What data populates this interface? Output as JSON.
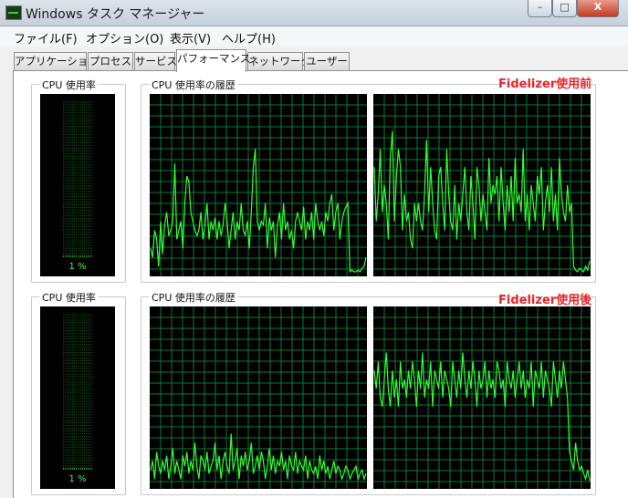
{
  "window": {
    "title": "Windows タスク マネージャー"
  },
  "titlebar_buttons": {
    "minimize": "–",
    "maximize": "□",
    "close": "X"
  },
  "menu": [
    "ファイル(F)",
    "オプション(O)",
    "表示(V)",
    "ヘルプ(H)"
  ],
  "tabs": [
    {
      "label": "アプリケーション",
      "active": false
    },
    {
      "label": "プロセス",
      "active": false
    },
    {
      "label": "サービス",
      "active": false
    },
    {
      "label": "パフォーマンス",
      "active": true
    },
    {
      "label": "ネットワーク",
      "active": false
    },
    {
      "label": "ユーザー",
      "active": false
    }
  ],
  "colors": {
    "graph_line": "#33ff33",
    "grid": "#0e7a32",
    "meter_on": "#3cff3c",
    "meter_off": "#0a5c1a",
    "annotation": "#e8262a"
  },
  "sections": [
    {
      "note": "Fidelizer使用前",
      "usage_label": "CPU 使用率",
      "usage_value": "1 %",
      "usage_fraction": 0.01,
      "history_label": "CPU 使用率の履歴",
      "cores": [
        {
          "values": [
            15,
            10,
            25,
            20,
            5,
            30,
            12,
            28,
            35,
            22,
            25,
            30,
            62,
            20,
            25,
            30,
            15,
            40,
            55,
            52,
            35,
            30,
            25,
            22,
            25,
            35,
            20,
            28,
            40,
            20,
            30,
            25,
            32,
            20,
            30,
            22,
            28,
            40,
            30,
            15,
            25,
            35,
            20,
            30,
            25,
            40,
            25,
            22,
            30,
            15,
            35,
            60,
            70,
            30,
            25,
            30,
            28,
            40,
            15,
            32,
            25,
            30,
            10,
            28,
            35,
            20,
            40,
            25,
            30,
            20,
            25,
            15,
            30,
            35,
            30,
            25,
            38,
            20,
            30,
            25,
            35,
            20,
            40,
            30,
            25,
            30,
            22,
            35,
            30,
            40,
            45,
            25,
            35,
            40,
            20,
            30,
            35,
            38,
            40,
            2,
            3,
            2,
            2,
            3,
            2,
            4,
            5,
            10
          ]
        },
        {
          "values": [
            60,
            30,
            45,
            70,
            35,
            50,
            40,
            20,
            65,
            80,
            30,
            55,
            70,
            60,
            25,
            45,
            30,
            35,
            20,
            15,
            40,
            30,
            40,
            30,
            25,
            45,
            75,
            35,
            60,
            40,
            25,
            20,
            55,
            60,
            40,
            25,
            70,
            45,
            30,
            25,
            50,
            20,
            40,
            30,
            45,
            60,
            35,
            25,
            55,
            40,
            20,
            60,
            50,
            30,
            45,
            35,
            25,
            65,
            40,
            50,
            45,
            55,
            30,
            60,
            40,
            25,
            50,
            35,
            55,
            30,
            65,
            40,
            45,
            35,
            70,
            30,
            45,
            25,
            50,
            40,
            30,
            55,
            45,
            60,
            25,
            40,
            50,
            35,
            60,
            30,
            45,
            25,
            65,
            45,
            35,
            30,
            50,
            35,
            40,
            5,
            3,
            2,
            4,
            3,
            2,
            5,
            3,
            8
          ]
        }
      ]
    },
    {
      "note": "Fidelizer使用後",
      "usage_label": "CPU 使用率",
      "usage_value": "1 %",
      "usage_fraction": 0.01,
      "history_label": "CPU 使用率の履歴",
      "cores": [
        {
          "values": [
            10,
            15,
            5,
            20,
            12,
            8,
            15,
            10,
            18,
            5,
            12,
            22,
            8,
            15,
            10,
            5,
            18,
            12,
            20,
            8,
            15,
            10,
            25,
            12,
            5,
            18,
            15,
            10,
            20,
            8,
            12,
            15,
            25,
            10,
            18,
            5,
            15,
            20,
            12,
            8,
            30,
            10,
            15,
            22,
            5,
            18,
            12,
            20,
            10,
            15,
            25,
            8,
            12,
            18,
            10,
            20,
            15,
            5,
            12,
            22,
            10,
            18,
            8,
            15,
            12,
            20,
            10,
            15,
            5,
            18,
            12,
            10,
            20,
            8,
            15,
            12,
            10,
            18,
            5,
            15,
            10,
            8,
            12,
            5,
            18,
            10,
            15,
            8,
            12,
            5,
            10,
            15,
            8,
            12,
            10,
            5,
            8,
            12,
            10,
            5,
            8,
            10,
            12,
            5,
            8,
            10,
            5,
            8
          ]
        },
        {
          "values": [
            65,
            55,
            70,
            50,
            45,
            60,
            75,
            55,
            45,
            65,
            50,
            60,
            45,
            70,
            55,
            60,
            50,
            65,
            55,
            70,
            60,
            45,
            65,
            55,
            75,
            50,
            60,
            55,
            70,
            45,
            65,
            60,
            55,
            70,
            50,
            65,
            60,
            55,
            45,
            70,
            60,
            50,
            65,
            55,
            75,
            60,
            50,
            65,
            55,
            70,
            60,
            45,
            65,
            55,
            60,
            70,
            50,
            65,
            55,
            60,
            50,
            70,
            65,
            55,
            60,
            45,
            70,
            60,
            55,
            65,
            50,
            60,
            70,
            55,
            65,
            50,
            60,
            55,
            70,
            45,
            65,
            60,
            55,
            70,
            50,
            65,
            60,
            55,
            45,
            70,
            60,
            50,
            65,
            55,
            70,
            60,
            50,
            20,
            15,
            10,
            25,
            15,
            10,
            12,
            8,
            5,
            10,
            4
          ]
        }
      ]
    }
  ]
}
